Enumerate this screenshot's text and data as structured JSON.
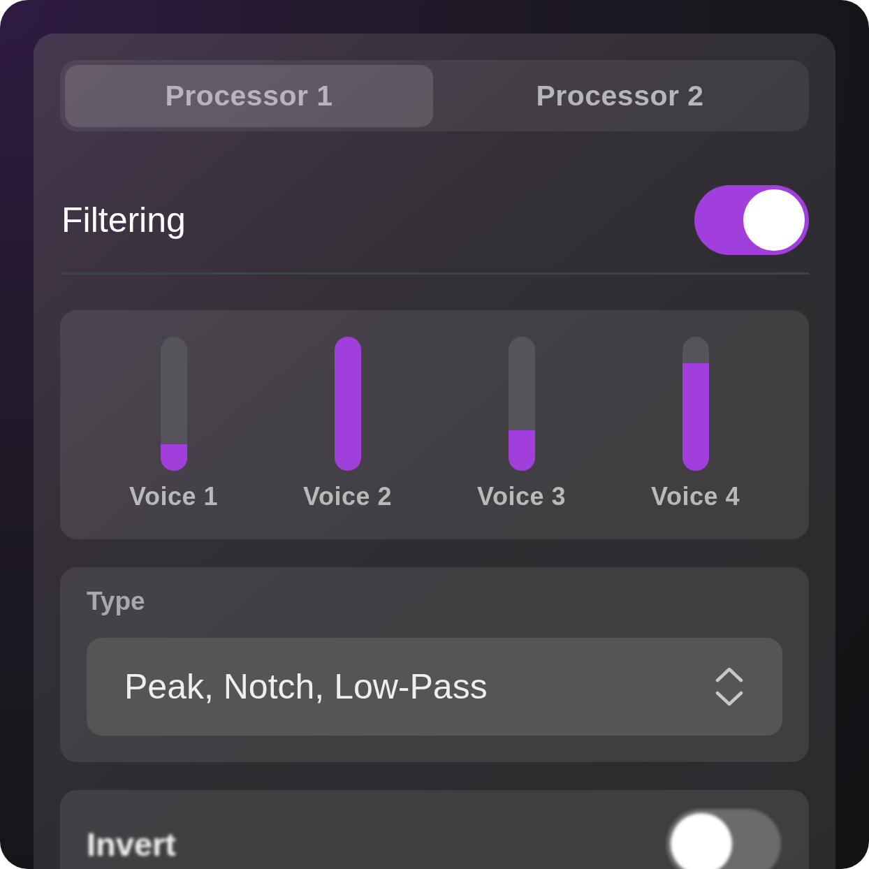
{
  "tabs": [
    {
      "label": "Processor 1",
      "selected": true
    },
    {
      "label": "Processor 2",
      "selected": false
    }
  ],
  "filtering": {
    "label": "Filtering",
    "on": true
  },
  "voices": [
    {
      "label": "Voice 1",
      "level": 0.2
    },
    {
      "label": "Voice 2",
      "level": 1
    },
    {
      "label": "Voice 3",
      "level": 0.3
    },
    {
      "label": "Voice 4",
      "level": 0.8
    }
  ],
  "type": {
    "label": "Type",
    "value": "Peak, Notch, Low-Pass"
  },
  "invert": {
    "label": "Invert",
    "on": false
  }
}
